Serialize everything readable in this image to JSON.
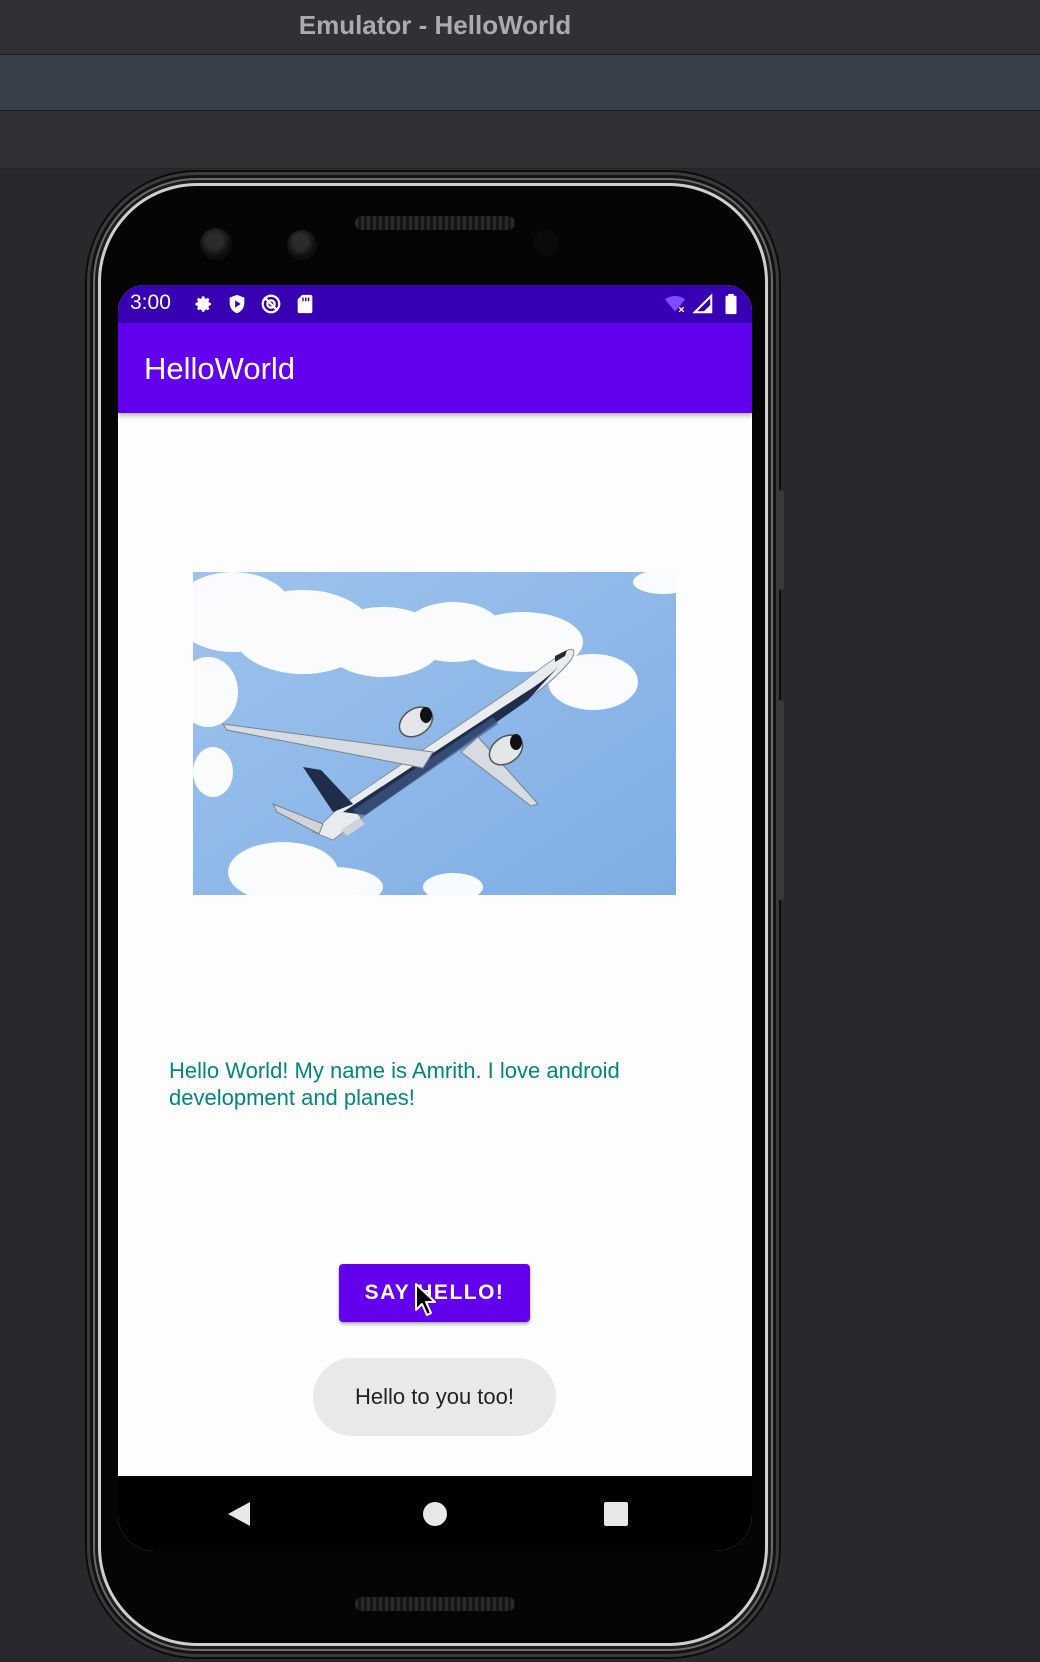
{
  "window": {
    "title": "Emulator - HelloWorld"
  },
  "status_bar": {
    "time": "3:00",
    "icons": [
      "settings-icon",
      "shield-icon",
      "sync-disabled-icon",
      "sd-card-icon",
      "wifi-no-internet-icon",
      "cell-signal-icon",
      "battery-icon"
    ]
  },
  "app_bar": {
    "title": "HelloWorld"
  },
  "content": {
    "image": "airplane-image",
    "message": "Hello World! My name is Amrith. I love android development and planes!",
    "button_label": "SAY HELLO!",
    "toast": "Hello to you too!"
  },
  "nav_bar": {
    "icons": [
      "back-icon",
      "home-icon",
      "recents-icon"
    ]
  },
  "colors": {
    "primary": "#6200ee",
    "primary_dark": "#3700b3",
    "message_text": "#03857f",
    "toast_bg": "#e9e9e9"
  }
}
